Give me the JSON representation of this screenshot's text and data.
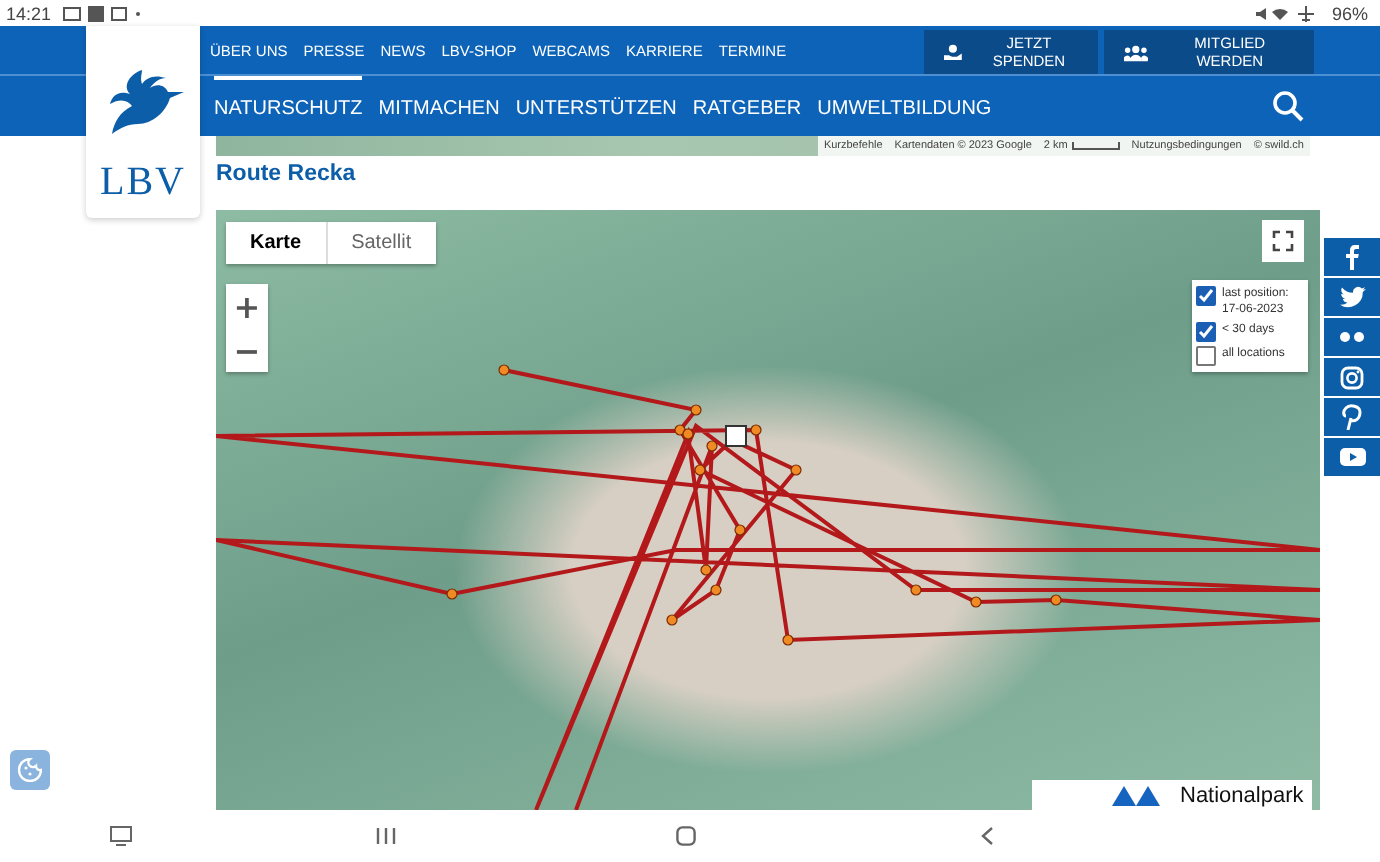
{
  "status_bar": {
    "time": "14:21",
    "battery": "96%"
  },
  "header": {
    "logo_text": "LBV",
    "top_links": [
      "ÜBER UNS",
      "PRESSE",
      "NEWS",
      "LBV-SHOP",
      "WEBCAMS",
      "KARRIERE",
      "TERMINE"
    ],
    "actions": [
      {
        "label": "JETZT SPENDEN",
        "kind": "donate"
      },
      {
        "label": "MITGLIED WERDEN",
        "kind": "members"
      }
    ],
    "nav": [
      {
        "label": "NATURSCHUTZ",
        "selected": true
      },
      {
        "label": "MITMACHEN",
        "selected": false
      },
      {
        "label": "UNTERSTÜTZEN",
        "selected": false
      },
      {
        "label": "RATGEBER",
        "selected": false
      },
      {
        "label": "UMWELTBILDUNG",
        "selected": false
      }
    ]
  },
  "map_strip": {
    "attribution": [
      "Kurzbefehle",
      "Kartendaten © 2023 Google",
      "2 km",
      "Nutzungsbedingungen",
      "© swild.ch"
    ]
  },
  "page_title": "Route Recka",
  "map": {
    "types": [
      {
        "label": "Karte",
        "selected": true
      },
      {
        "label": "Satellit",
        "selected": false
      }
    ],
    "zoom_in": "+",
    "zoom_out": "−",
    "legend": [
      {
        "label": "last position: 17-06-2023",
        "checked": true
      },
      {
        "label": "< 30 days",
        "checked": true
      },
      {
        "label": "all locations",
        "checked": false
      }
    ],
    "partner_label": "Nationalpark"
  },
  "social": [
    {
      "kind": "facebook"
    },
    {
      "kind": "twitter"
    },
    {
      "kind": "flickr"
    },
    {
      "kind": "instagram"
    },
    {
      "kind": "pinterest"
    },
    {
      "kind": "youtube"
    }
  ]
}
